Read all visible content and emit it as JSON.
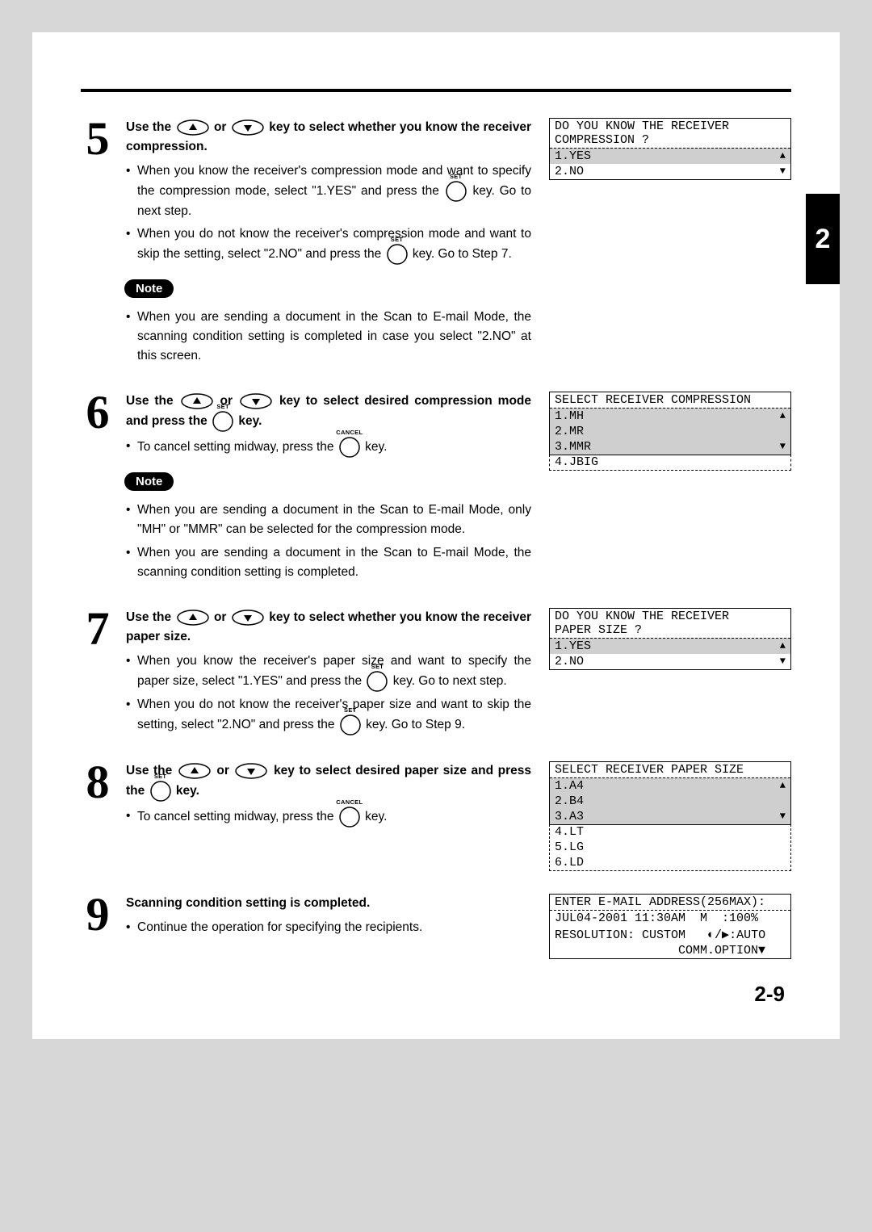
{
  "page_number": "2-9",
  "chapter_tab": "2",
  "steps": [
    {
      "num": "5",
      "title_a": "Use the ",
      "title_b": " or ",
      "title_c": " key to select whether you know the receiver compression.",
      "b1": "When you know the receiver's compression mode and want to specify the compression mode, select \"1.YES\" and press the ",
      "b1b": " key.  Go to next step.",
      "b2": "When you do not know the receiver's compression mode and want to skip the setting, select \"2.NO\" and press the ",
      "b2b": " key.  Go to Step 7.",
      "note": "Note",
      "n1": "When you are sending a document in the Scan to E-mail Mode, the scanning condition setting is completed in case you select \"2.NO\" at this screen.",
      "lcd_heading": "DO YOU KNOW THE RECEIVER\nCOMPRESSION ?",
      "lcd_opt1": "1.YES",
      "lcd_opt2": "2.NO"
    },
    {
      "num": "6",
      "title_a": "Use the ",
      "title_b": " or ",
      "title_c": " key to select desired compression mode and press the ",
      "title_d": " key.",
      "b1": "To cancel setting midway, press the ",
      "b1b": " key.",
      "note": "Note",
      "n1": "When you are sending a document in the Scan to E-mail Mode, only \"MH\" or \"MMR\" can be selected for the compression mode.",
      "n2": "When you are sending a document in the Scan to E-mail Mode, the scanning condition setting is completed.",
      "lcd_heading": "SELECT RECEIVER COMPRESSION",
      "lcd_rows": [
        "1.MH",
        "2.MR",
        "3.MMR"
      ],
      "lcd_ext": [
        "4.JBIG"
      ]
    },
    {
      "num": "7",
      "title_a": "Use the ",
      "title_b": " or ",
      "title_c": " key to select whether you know the receiver paper size.",
      "b1": "When you know the receiver's paper size and want to specify the paper size, select \"1.YES\" and press the ",
      "b1b": " key.  Go to next step.",
      "b2": "When you do not know the receiver's paper size and want to skip the setting, select \"2.NO\" and press the ",
      "b2b": " key. Go to Step 9.",
      "lcd_heading": "DO YOU KNOW THE RECEIVER\nPAPER SIZE ?",
      "lcd_opt1": "1.YES",
      "lcd_opt2": "2.NO"
    },
    {
      "num": "8",
      "title_a": "Use the ",
      "title_b": " or ",
      "title_c": " key to select desired paper size and press the ",
      "title_d": " key.",
      "b1": "To cancel setting midway, press the ",
      "b1b": " key.",
      "lcd_heading": "SELECT RECEIVER PAPER SIZE",
      "lcd_rows": [
        "1.A4",
        "2.B4",
        "3.A3"
      ],
      "lcd_ext": [
        "4.LT",
        "5.LG",
        "6.LD"
      ]
    },
    {
      "num": "9",
      "title": "Scanning condition setting is completed.",
      "b1": "Continue the operation for specifying the recipients.",
      "lcd_rows": [
        "ENTER E-MAIL ADDRESS(256MAX):",
        "JUL04-2001 11:30AM  M  :100%",
        "RESOLUTION: CUSTOM   ◐/▶:AUTO",
        "                 COMM.OPTION▼"
      ]
    }
  ],
  "key_labels": {
    "set": "SET",
    "cancel": "CANCEL"
  }
}
